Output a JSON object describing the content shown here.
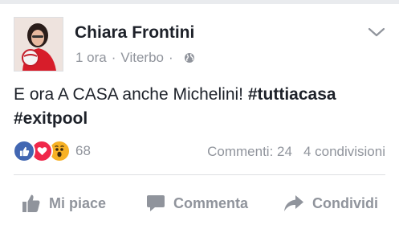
{
  "post": {
    "author": "Chiara Frontini",
    "time": "1 ora",
    "separator": "·",
    "location": "Viterbo",
    "separator2": "·",
    "privacy_icon": "globe-icon",
    "text_plain": "E ora A CASA anche Michelini!",
    "hashtag1": "#tuttiacasa",
    "hashtag2": "#exitpool"
  },
  "reactions": {
    "icons": [
      "like-icon",
      "love-icon",
      "wow-icon"
    ],
    "count": "68"
  },
  "stats": {
    "comments": "Commenti: 24",
    "shares": "4 condivisioni"
  },
  "actions": {
    "like_label": "Mi piace",
    "comment_label": "Commenta",
    "share_label": "Condividi"
  },
  "colors": {
    "like": "#4267b2",
    "love": "#f0284a",
    "wow": "#f7b125",
    "muted": "#90949c",
    "text": "#1d2129"
  }
}
